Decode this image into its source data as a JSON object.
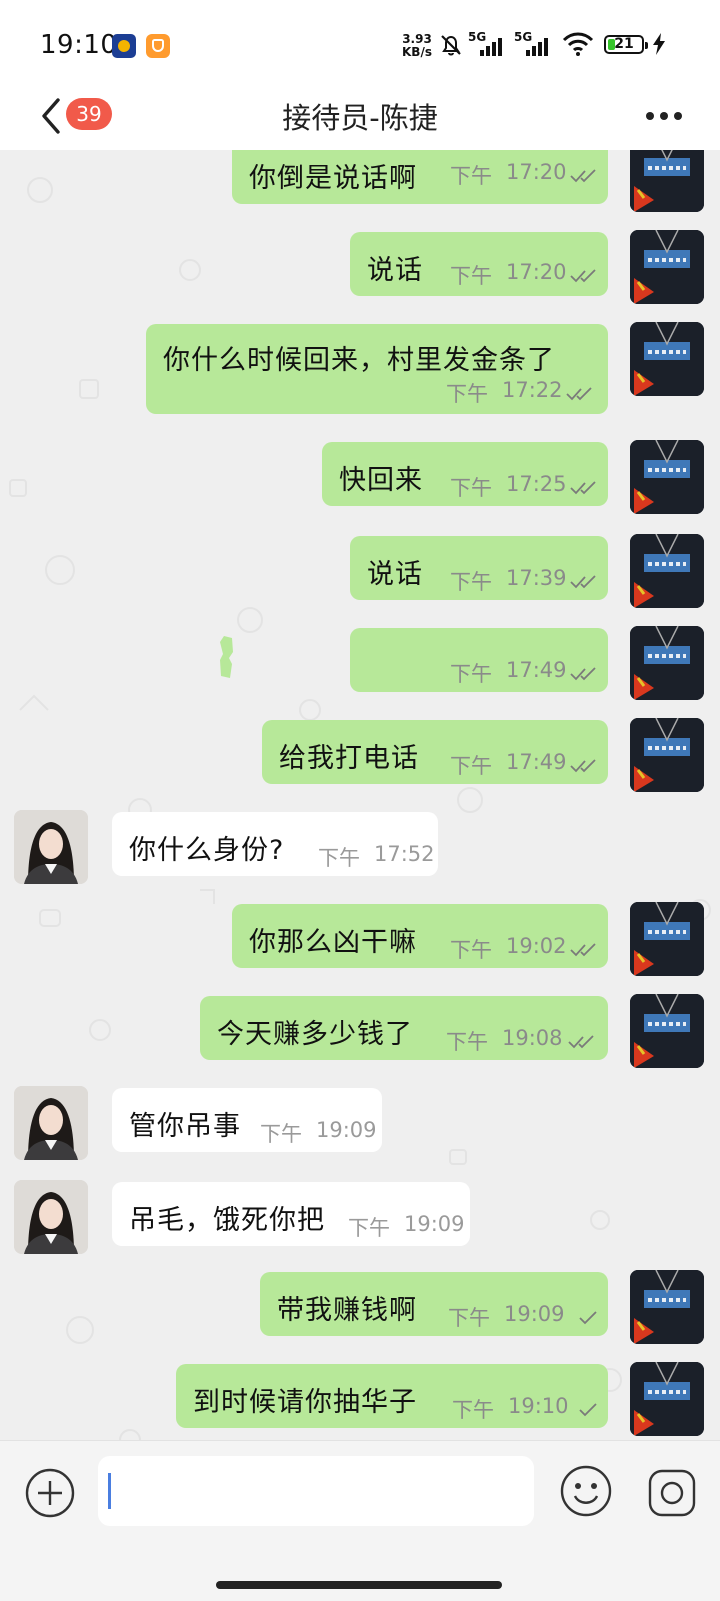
{
  "status_bar": {
    "time": "19:10",
    "speed_value": "3.93",
    "speed_unit": "KB/s",
    "signal1_label": "5G",
    "signal2_label": "5G",
    "battery": "21"
  },
  "navbar": {
    "unread_count": "39",
    "title": "接待员-陈捷"
  },
  "messages": [
    {
      "sender": "me",
      "text": "你倒是说话啊",
      "period": "下午",
      "time": "17:20",
      "status": "read"
    },
    {
      "sender": "me",
      "text": "说话",
      "period": "下午",
      "time": "17:20",
      "status": "read"
    },
    {
      "sender": "me",
      "text": "你什么时候回来，村里发金条了",
      "period": "下午",
      "time": "17:22",
      "status": "read"
    },
    {
      "sender": "me",
      "text": "快回来",
      "period": "下午",
      "time": "17:25",
      "status": "read"
    },
    {
      "sender": "me",
      "text": "说话",
      "period": "下午",
      "time": "17:39",
      "status": "read"
    },
    {
      "sender": "me",
      "text": "",
      "period": "下午",
      "time": "17:49",
      "status": "read"
    },
    {
      "sender": "me",
      "text": "给我打电话",
      "period": "下午",
      "time": "17:49",
      "status": "read"
    },
    {
      "sender": "other",
      "text": "你什么身份?",
      "period": "下午",
      "time": "17:52"
    },
    {
      "sender": "me",
      "text": "你那么凶干嘛",
      "period": "下午",
      "time": "19:02",
      "status": "read"
    },
    {
      "sender": "me",
      "text": "今天赚多少钱了",
      "period": "下午",
      "time": "19:08",
      "status": "read"
    },
    {
      "sender": "other",
      "text": "管你吊事",
      "period": "下午",
      "time": "19:09"
    },
    {
      "sender": "other",
      "text": "吊毛，饿死你把",
      "period": "下午",
      "time": "19:09"
    },
    {
      "sender": "me",
      "text": "带我赚钱啊",
      "period": "下午",
      "time": "19:09",
      "status": "sent"
    },
    {
      "sender": "me",
      "text": "到时候请你抽华子",
      "period": "下午",
      "time": "19:10",
      "status": "sent"
    }
  ],
  "input": {
    "placeholder": ""
  },
  "colors": {
    "my_bubble": "#b7e899",
    "other_bubble": "#ffffff",
    "badge": "#f15a4a",
    "chat_background": "#efefef"
  }
}
